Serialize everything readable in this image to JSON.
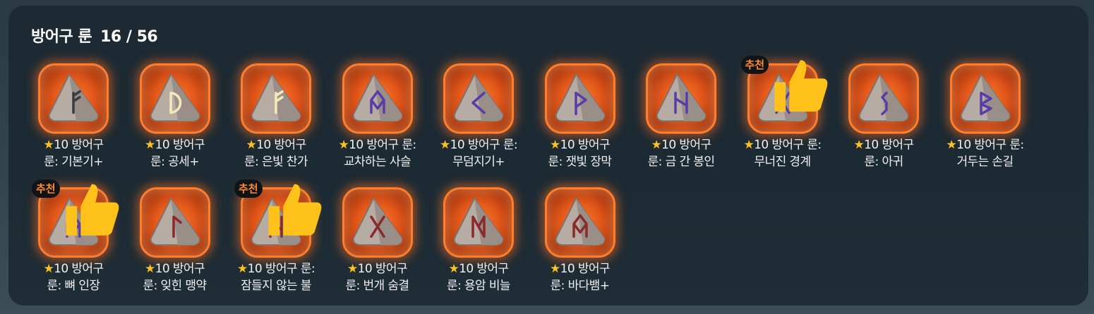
{
  "header": {
    "title": "방어구 룬",
    "count": "16 / 56"
  },
  "colors": {
    "accent": "#ff7e2e",
    "star": "#ffc21a",
    "badge_text": "#ff8a2a"
  },
  "badge_label": "추천",
  "items": [
    {
      "star": "★",
      "grade": "10",
      "line1": "방어구",
      "line2": "룬: 기본기+",
      "glyph": "F",
      "glyph_color": "#3a3c3f",
      "recommended": false
    },
    {
      "star": "★",
      "grade": "10",
      "line1": "방어구",
      "line2": "룬: 공세+",
      "glyph": "D",
      "glyph_color": "#f4e9b8",
      "recommended": false
    },
    {
      "star": "★",
      "grade": "10",
      "line1": "방어구",
      "line2": "룬: 은빛 찬가",
      "glyph": "F",
      "glyph_color": "#f4e9b8",
      "recommended": false
    },
    {
      "star": "★",
      "grade": "10",
      "line1": "방어구 룬:",
      "line2": "교차하는 사슬",
      "glyph": "O",
      "glyph_color": "#5a3ca8",
      "recommended": false
    },
    {
      "star": "★",
      "grade": "10",
      "line1": "방어구 룬:",
      "line2": "무덤지기+",
      "glyph": "<",
      "glyph_color": "#5a3ca8",
      "recommended": false
    },
    {
      "star": "★",
      "grade": "10",
      "line1": "방어구",
      "line2": "룬: 잿빛 장막",
      "glyph": "P",
      "glyph_color": "#5a3ca8",
      "recommended": false
    },
    {
      "star": "★",
      "grade": "10",
      "line1": "방어구",
      "line2": "룬: 금 간 봉인",
      "glyph": "H",
      "glyph_color": "#5a3ca8",
      "recommended": false
    },
    {
      "star": "★",
      "grade": "10",
      "line1": "방어구 룬:",
      "line2": "무너진 경계",
      "glyph": "X",
      "glyph_color": "#5a3ca8",
      "recommended": true
    },
    {
      "star": "★",
      "grade": "10",
      "line1": "방어구",
      "line2": "룬: 아귀",
      "glyph": "S",
      "glyph_color": "#5a3ca8",
      "recommended": false
    },
    {
      "star": "★",
      "grade": "10",
      "line1": "방어구 룬:",
      "line2": "거두는 손길",
      "glyph": "B",
      "glyph_color": "#5a3ca8",
      "recommended": false
    },
    {
      "star": "★",
      "grade": "10",
      "line1": "방어구",
      "line2": "룬: 뼈 인장",
      "glyph": "O",
      "glyph_color": "#5a3ca8",
      "recommended": true
    },
    {
      "star": "★",
      "grade": "10",
      "line1": "방어구",
      "line2": "룬: 잊힌 맹약",
      "glyph": "T",
      "glyph_color": "#8a2a2a",
      "recommended": false
    },
    {
      "star": "★",
      "grade": "10",
      "line1": "방어구 룬:",
      "line2": "잠들지 않는 불",
      "glyph": "H",
      "glyph_color": "#8a2a2a",
      "recommended": true
    },
    {
      "star": "★",
      "grade": "10",
      "line1": "방어구",
      "line2": "룬: 번개 숨결",
      "glyph": "X",
      "glyph_color": "#8a2a2a",
      "recommended": false
    },
    {
      "star": "★",
      "grade": "10",
      "line1": "방어구",
      "line2": "룬: 용암 비늘",
      "glyph": "M",
      "glyph_color": "#8a2a2a",
      "recommended": false
    },
    {
      "star": "★",
      "grade": "10",
      "line1": "방어구",
      "line2": "룬: 바다뱀+",
      "glyph": "O",
      "glyph_color": "#8a2a2a",
      "recommended": false
    }
  ]
}
